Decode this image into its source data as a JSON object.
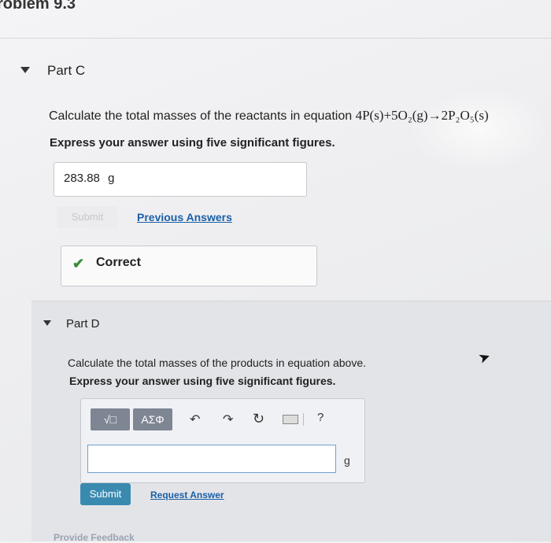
{
  "problem": {
    "title": "roblem 9.3"
  },
  "partC": {
    "label": "Part C",
    "question_prefix": "Calculate the total masses of the reactants in equation",
    "equation": "4P(s)+5O₂(g)→2P₂O₅(s)",
    "instruction": "Express your answer using five significant figures.",
    "answer_value": "283.88",
    "answer_unit": "g",
    "submit_label": "Submit",
    "previous_answers_label": "Previous Answers",
    "feedback_text": "Correct"
  },
  "partD": {
    "label": "Part D",
    "question": "Calculate the total masses of the products in equation above.",
    "instruction": "Express your answer using five significant figures.",
    "toolbar": {
      "template_label": "√□",
      "symbols_label": "ΑΣΦ",
      "undo_icon": "undo-icon",
      "redo_icon": "redo-icon",
      "reset_icon": "reset-icon",
      "keyboard_icon": "keyboard-icon",
      "help_label": "?"
    },
    "answer_value": "",
    "unit": "g",
    "submit_label": "Submit",
    "request_answer_label": "Request Answer",
    "provide_feedback_label": "Provide Feedback"
  },
  "colors": {
    "accent": "#3a8ab0",
    "link": "#1a5fa8",
    "correct": "#3b8b3b"
  }
}
